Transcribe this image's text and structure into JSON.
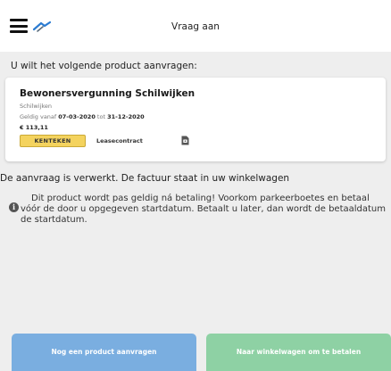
{
  "header": {
    "title": "Vraag aan"
  },
  "intro": "U wilt het volgende product aanvragen:",
  "product": {
    "title": "Bewonersvergunning Schilwijken",
    "subtitle": "Schilwijken",
    "valid_label": "Geldig vanaf",
    "valid_from": "07-03-2020",
    "valid_to_label": "tot",
    "valid_to": "31-12-2020",
    "price": "€ 113,11",
    "badge": "KENTEKEN",
    "lease": "Leasecontract"
  },
  "status": "De aanvraag is verwerkt. De factuur staat in uw winkelwagen",
  "info": "Dit product wordt pas geldig ná betaling! Voorkom parkeerboetes en betaal vóór de door u opgegeven startdatum. Betaalt u later, dan wordt de betaaldatum de startdatum.",
  "buttons": {
    "another": "Nog een product aanvragen",
    "cart": "Naar winkelwagen om te betalen"
  },
  "colors": {
    "badge": "#f4d35e",
    "button_primary": "#7aaee0",
    "button_success": "#8ed1a4",
    "logo": "#2b7bd1"
  },
  "icons": [
    "menu-icon",
    "logo-icon",
    "document-icon",
    "info-icon"
  ]
}
